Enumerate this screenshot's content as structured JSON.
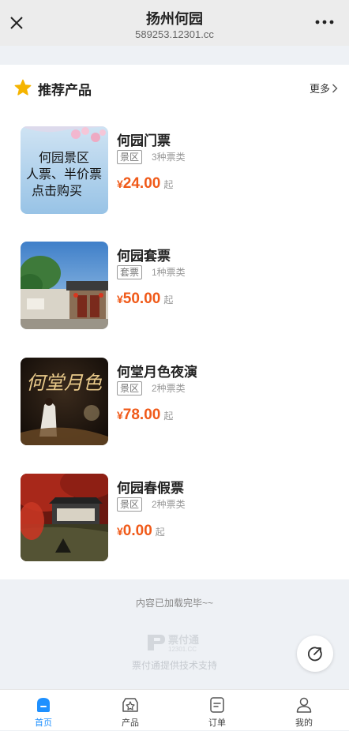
{
  "header": {
    "title": "扬州何园",
    "url": "589253.12301.cc"
  },
  "section": {
    "title": "推荐产品",
    "more_label": "更多"
  },
  "products": [
    {
      "name": "何园门票",
      "tag": "景区",
      "kinds": "3种票类",
      "currency": "¥",
      "price": "24.00",
      "suffix": "起",
      "thumb_text": [
        "何园景区",
        "人票、半价票",
        "点击购买"
      ]
    },
    {
      "name": "何园套票",
      "tag": "套票",
      "kinds": "1种票类",
      "currency": "¥",
      "price": "50.00",
      "suffix": "起"
    },
    {
      "name": "何堂月色夜演",
      "tag": "景区",
      "kinds": "2种票类",
      "currency": "¥",
      "price": "78.00",
      "suffix": "起",
      "thumb_text": [
        "何堂月色"
      ]
    },
    {
      "name": "何园春假票",
      "tag": "景区",
      "kinds": "2种票类",
      "currency": "¥",
      "price": "0.00",
      "suffix": "起"
    }
  ],
  "footer": {
    "loaded_text": "内容已加载完毕~~",
    "brand": "票付通",
    "brand_domain": "12301.CC",
    "support_text": "票付通提供技术支持"
  },
  "tabbar": [
    {
      "label": "首页",
      "icon": "home-icon",
      "active": true
    },
    {
      "label": "产品",
      "icon": "product-icon",
      "active": false
    },
    {
      "label": "订单",
      "icon": "order-icon",
      "active": false
    },
    {
      "label": "我的",
      "icon": "profile-icon",
      "active": false
    }
  ],
  "colors": {
    "accent": "#1e90ff",
    "price": "#f05a19",
    "star": "#f5b400"
  }
}
